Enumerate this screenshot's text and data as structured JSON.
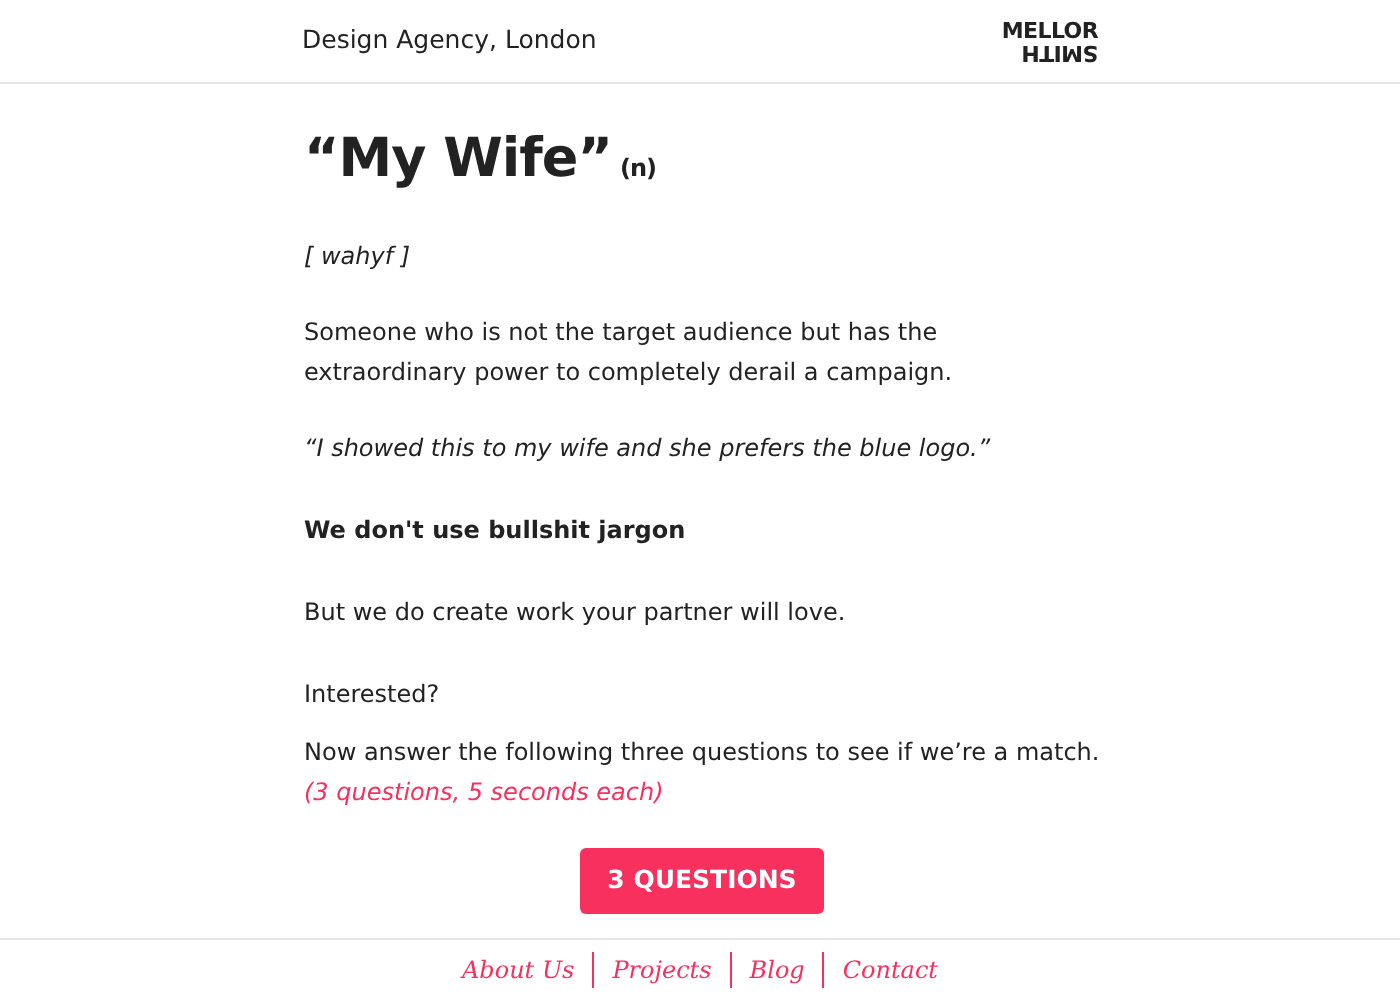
{
  "header": {
    "tagline": "Design Agency, London",
    "logo": [
      "MELLOR",
      "SMITH"
    ]
  },
  "entry": {
    "word": "“My Wife”",
    "part_of_speech": "(n)",
    "pronunciation": "[ wahyf ]",
    "definition": "Someone who is not the target audience but has the extraordinary power to completely derail a campaign.",
    "example": "“I showed this to my wife and she prefers the blue logo.”"
  },
  "pitch": {
    "heading": "We don't use bullshit jargon",
    "paragraphs": [
      "But we do create work your partner will love.",
      "Interested?",
      "Now answer the following three questions to see if we’re a match."
    ],
    "note": "(3 questions, 5 seconds each)"
  },
  "button": "3 QUESTIONS",
  "footer_links": [
    "About Us",
    "Projects",
    "Blog",
    "Contact"
  ]
}
